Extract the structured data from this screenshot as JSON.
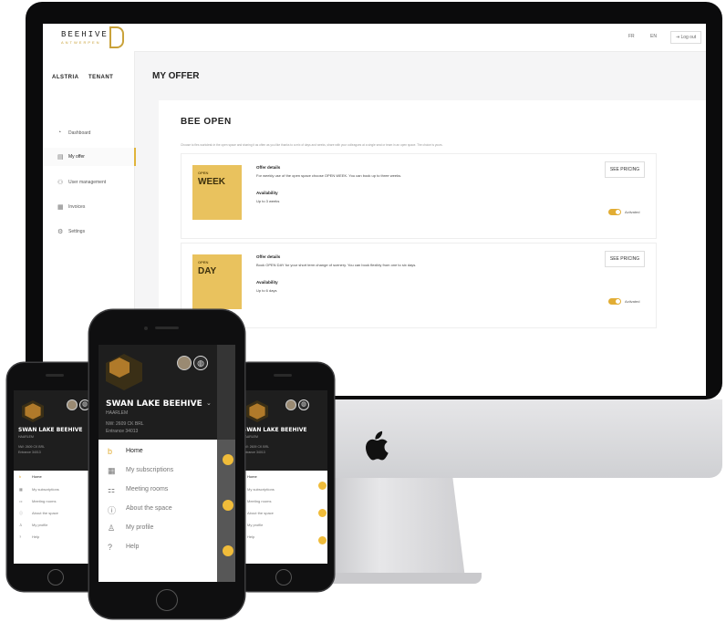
{
  "desktop": {
    "logo": "BEEHIVE",
    "logo_sub": "ANTWERPEN",
    "top_links": [
      "FR",
      "EN"
    ],
    "login": "Log out",
    "org": "ALSTRIA",
    "role": "TENANT",
    "nav": [
      {
        "label": "Dashboard",
        "icon": "dashboard-icon",
        "glyph": "◔"
      },
      {
        "label": "My offer",
        "icon": "offer-icon",
        "glyph": "▤"
      },
      {
        "label": "User management",
        "icon": "users-icon",
        "glyph": "⚇"
      },
      {
        "label": "Invoices",
        "icon": "invoice-icon",
        "glyph": "▦"
      },
      {
        "label": "Settings",
        "icon": "gear-icon",
        "glyph": "⚙"
      }
    ],
    "page_title": "MY OFFER",
    "section_title": "BEE OPEN",
    "intro": "Choose to flex-workdesk in the open space and sharing it as often as you like thanks to a mix of days and weeks, share with your colleagues at a single seat or team in an open space. The choice is yours.",
    "offers": [
      {
        "tag": "OPEN",
        "name": "WEEK",
        "details_label": "Offer details",
        "details": "For weekly use of the open space choose OPEN WEEK. You can book up to three weeks.",
        "availability_label": "Availability",
        "availability": "Up to 3 weeks",
        "button": "SEE PRICING",
        "toggle": "Activated"
      },
      {
        "tag": "OPEN",
        "name": "DAY",
        "details_label": "Offer details",
        "details": "Book OPEN DAY for your short term change of scenery. You can book flexibly from one to six days.",
        "availability_label": "Availability",
        "availability": "Up to 6 days",
        "button": "SEE PRICING",
        "toggle": "Activated"
      }
    ]
  },
  "mobile": {
    "venue": "SWAN LAKE BEEHIVE",
    "venue_sub": "HAARLEM",
    "address": "NW: 2609 CK BRL",
    "entrance": "Entrance 34013",
    "menu": [
      {
        "label": "Home",
        "icon": "home-icon",
        "glyph": "b"
      },
      {
        "label": "My subscriptions",
        "icon": "subscriptions-icon",
        "glyph": "▦"
      },
      {
        "label": "Meeting rooms",
        "icon": "meeting-icon",
        "glyph": "⚏"
      },
      {
        "label": "About the space",
        "icon": "info-icon",
        "glyph": "ⓘ"
      },
      {
        "label": "My profile",
        "icon": "profile-icon",
        "glyph": "♙"
      },
      {
        "label": "Help",
        "icon": "help-icon",
        "glyph": "?"
      }
    ]
  },
  "colors": {
    "accent": "#e2ad34",
    "thumb": "#e9c25e",
    "dark": "#1e1e1e"
  }
}
